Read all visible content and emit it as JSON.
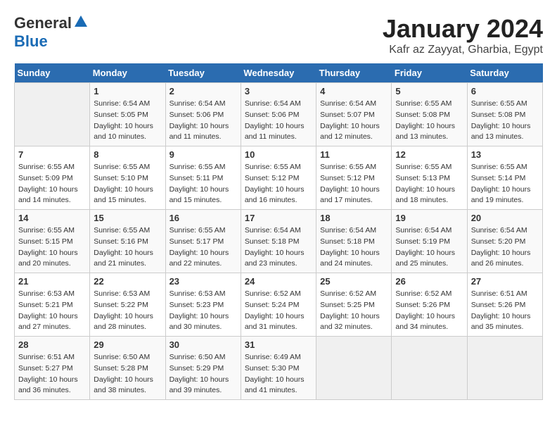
{
  "logo": {
    "general": "General",
    "blue": "Blue"
  },
  "title": "January 2024",
  "location": "Kafr az Zayyat, Gharbia, Egypt",
  "days_header": [
    "Sunday",
    "Monday",
    "Tuesday",
    "Wednesday",
    "Thursday",
    "Friday",
    "Saturday"
  ],
  "weeks": [
    [
      {
        "day": "",
        "info": ""
      },
      {
        "day": "1",
        "info": "Sunrise: 6:54 AM\nSunset: 5:05 PM\nDaylight: 10 hours\nand 10 minutes."
      },
      {
        "day": "2",
        "info": "Sunrise: 6:54 AM\nSunset: 5:06 PM\nDaylight: 10 hours\nand 11 minutes."
      },
      {
        "day": "3",
        "info": "Sunrise: 6:54 AM\nSunset: 5:06 PM\nDaylight: 10 hours\nand 11 minutes."
      },
      {
        "day": "4",
        "info": "Sunrise: 6:54 AM\nSunset: 5:07 PM\nDaylight: 10 hours\nand 12 minutes."
      },
      {
        "day": "5",
        "info": "Sunrise: 6:55 AM\nSunset: 5:08 PM\nDaylight: 10 hours\nand 13 minutes."
      },
      {
        "day": "6",
        "info": "Sunrise: 6:55 AM\nSunset: 5:08 PM\nDaylight: 10 hours\nand 13 minutes."
      }
    ],
    [
      {
        "day": "7",
        "info": "Sunrise: 6:55 AM\nSunset: 5:09 PM\nDaylight: 10 hours\nand 14 minutes."
      },
      {
        "day": "8",
        "info": "Sunrise: 6:55 AM\nSunset: 5:10 PM\nDaylight: 10 hours\nand 15 minutes."
      },
      {
        "day": "9",
        "info": "Sunrise: 6:55 AM\nSunset: 5:11 PM\nDaylight: 10 hours\nand 15 minutes."
      },
      {
        "day": "10",
        "info": "Sunrise: 6:55 AM\nSunset: 5:12 PM\nDaylight: 10 hours\nand 16 minutes."
      },
      {
        "day": "11",
        "info": "Sunrise: 6:55 AM\nSunset: 5:12 PM\nDaylight: 10 hours\nand 17 minutes."
      },
      {
        "day": "12",
        "info": "Sunrise: 6:55 AM\nSunset: 5:13 PM\nDaylight: 10 hours\nand 18 minutes."
      },
      {
        "day": "13",
        "info": "Sunrise: 6:55 AM\nSunset: 5:14 PM\nDaylight: 10 hours\nand 19 minutes."
      }
    ],
    [
      {
        "day": "14",
        "info": "Sunrise: 6:55 AM\nSunset: 5:15 PM\nDaylight: 10 hours\nand 20 minutes."
      },
      {
        "day": "15",
        "info": "Sunrise: 6:55 AM\nSunset: 5:16 PM\nDaylight: 10 hours\nand 21 minutes."
      },
      {
        "day": "16",
        "info": "Sunrise: 6:55 AM\nSunset: 5:17 PM\nDaylight: 10 hours\nand 22 minutes."
      },
      {
        "day": "17",
        "info": "Sunrise: 6:54 AM\nSunset: 5:18 PM\nDaylight: 10 hours\nand 23 minutes."
      },
      {
        "day": "18",
        "info": "Sunrise: 6:54 AM\nSunset: 5:18 PM\nDaylight: 10 hours\nand 24 minutes."
      },
      {
        "day": "19",
        "info": "Sunrise: 6:54 AM\nSunset: 5:19 PM\nDaylight: 10 hours\nand 25 minutes."
      },
      {
        "day": "20",
        "info": "Sunrise: 6:54 AM\nSunset: 5:20 PM\nDaylight: 10 hours\nand 26 minutes."
      }
    ],
    [
      {
        "day": "21",
        "info": "Sunrise: 6:53 AM\nSunset: 5:21 PM\nDaylight: 10 hours\nand 27 minutes."
      },
      {
        "day": "22",
        "info": "Sunrise: 6:53 AM\nSunset: 5:22 PM\nDaylight: 10 hours\nand 28 minutes."
      },
      {
        "day": "23",
        "info": "Sunrise: 6:53 AM\nSunset: 5:23 PM\nDaylight: 10 hours\nand 30 minutes."
      },
      {
        "day": "24",
        "info": "Sunrise: 6:52 AM\nSunset: 5:24 PM\nDaylight: 10 hours\nand 31 minutes."
      },
      {
        "day": "25",
        "info": "Sunrise: 6:52 AM\nSunset: 5:25 PM\nDaylight: 10 hours\nand 32 minutes."
      },
      {
        "day": "26",
        "info": "Sunrise: 6:52 AM\nSunset: 5:26 PM\nDaylight: 10 hours\nand 34 minutes."
      },
      {
        "day": "27",
        "info": "Sunrise: 6:51 AM\nSunset: 5:26 PM\nDaylight: 10 hours\nand 35 minutes."
      }
    ],
    [
      {
        "day": "28",
        "info": "Sunrise: 6:51 AM\nSunset: 5:27 PM\nDaylight: 10 hours\nand 36 minutes."
      },
      {
        "day": "29",
        "info": "Sunrise: 6:50 AM\nSunset: 5:28 PM\nDaylight: 10 hours\nand 38 minutes."
      },
      {
        "day": "30",
        "info": "Sunrise: 6:50 AM\nSunset: 5:29 PM\nDaylight: 10 hours\nand 39 minutes."
      },
      {
        "day": "31",
        "info": "Sunrise: 6:49 AM\nSunset: 5:30 PM\nDaylight: 10 hours\nand 41 minutes."
      },
      {
        "day": "",
        "info": ""
      },
      {
        "day": "",
        "info": ""
      },
      {
        "day": "",
        "info": ""
      }
    ]
  ]
}
